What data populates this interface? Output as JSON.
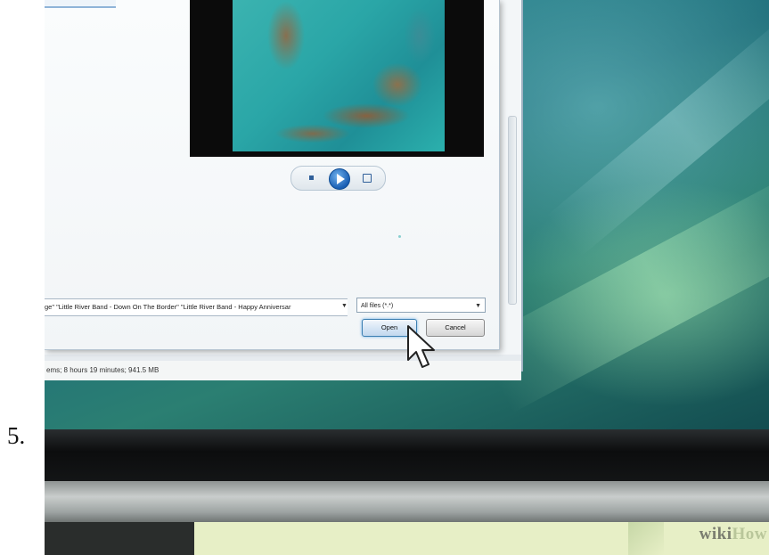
{
  "step_number": "5.",
  "dialog": {
    "file_names": "ge\" \"Little River Band - Down On The Border\" \"Little River Band - Happy Anniversar",
    "file_type_filter": "All files (*.*)",
    "open_label": "Open",
    "cancel_label": "Cancel"
  },
  "status_bar": {
    "text": "ems; 8 hours 19 minutes; 941.5 MB"
  },
  "watermark": {
    "wiki": "wiki",
    "how": "How"
  },
  "icons": {
    "player_stop": "stop-icon",
    "player_play": "play-icon",
    "player_mute": "mute-icon",
    "cursor": "mouse-cursor-icon"
  },
  "colors": {
    "desktop": "#1f6e7a",
    "open_button_glow": "#3c7fb1",
    "banner": "#e7efc6"
  }
}
